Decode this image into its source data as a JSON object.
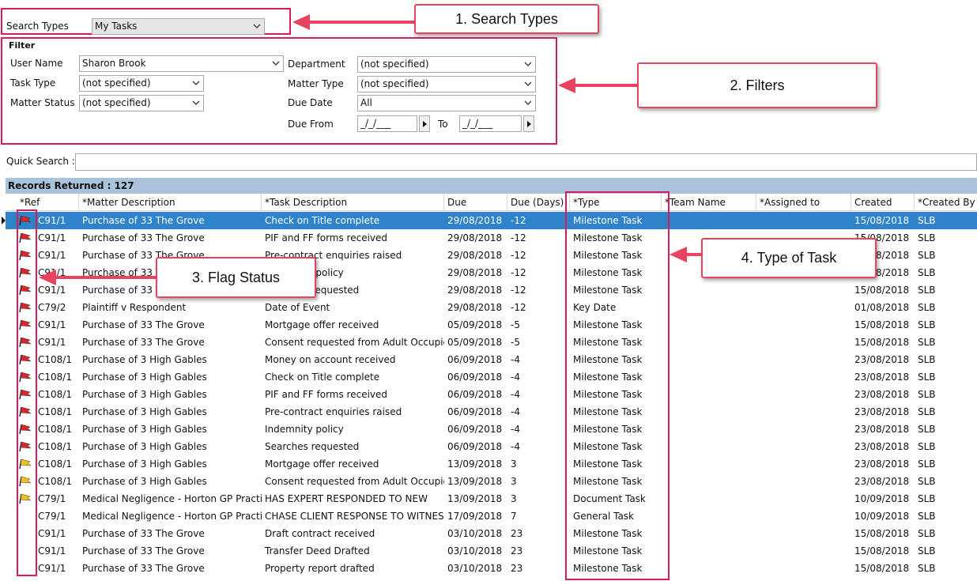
{
  "search": {
    "label": "Search Types",
    "value": "My Tasks"
  },
  "filter": {
    "title": "Filter",
    "user_name_label": "User Name",
    "user_name_value": "Sharon Brook",
    "task_type_label": "Task Type",
    "task_type_value": "(not specified)",
    "matter_status_label": "Matter Status",
    "matter_status_value": "(not specified)",
    "department_label": "Department",
    "department_value": "(not specified)",
    "matter_type_label": "Matter Type",
    "matter_type_value": "(not specified)",
    "due_date_label": "Due Date",
    "due_date_value": "All",
    "due_from_label": "Due From",
    "due_from_value": "_/_/___",
    "to_label": "To",
    "to_value": "_/_/___"
  },
  "quick_search": {
    "label": "Quick Search :",
    "value": ""
  },
  "records": {
    "label": "Records Returned : 127"
  },
  "columns": [
    "*Ref",
    "*Matter Description",
    "*Task Description",
    "Due",
    "Due (Days)",
    "*Type",
    "*Team Name",
    "*Assigned to",
    "Created",
    "*Created By"
  ],
  "rows": [
    {
      "flag": "red",
      "ref": "C91/1",
      "matter": "Purchase of 33 The Grove",
      "task": "Check on Title complete",
      "due": "29/08/2018",
      "days": "-12",
      "type": "Milestone Task",
      "team": "",
      "assigned": "",
      "created": "15/08/2018",
      "by": "SLB"
    },
    {
      "flag": "red",
      "ref": "C91/1",
      "matter": "Purchase of 33 The Grove",
      "task": "PIF and FF forms received",
      "due": "29/08/2018",
      "days": "-12",
      "type": "Milestone Task",
      "team": "",
      "assigned": "",
      "created": "15/08/2018",
      "by": "SLB"
    },
    {
      "flag": "red",
      "ref": "C91/1",
      "matter": "Purchase of 33 The Grove",
      "task": "Pre-contract enquiries raised",
      "due": "29/08/2018",
      "days": "-12",
      "type": "Milestone Task",
      "team": "",
      "assigned": "",
      "created": "15/08/2018",
      "by": "SLB"
    },
    {
      "flag": "red",
      "ref": "C91/1",
      "matter": "Purchase of 33 The Grove",
      "task": "Indemnity policy",
      "due": "29/08/2018",
      "days": "-12",
      "type": "Milestone Task",
      "team": "",
      "assigned": "",
      "created": "15/08/2018",
      "by": "SLB"
    },
    {
      "flag": "red",
      "ref": "C91/1",
      "matter": "Purchase of 33 The Grove",
      "task": "Searches requested",
      "due": "29/08/2018",
      "days": "-12",
      "type": "Milestone Task",
      "team": "",
      "assigned": "",
      "created": "15/08/2018",
      "by": "SLB"
    },
    {
      "flag": "red",
      "ref": "C79/2",
      "matter": "Plaintiff v Respondent",
      "task": "Date of Event",
      "due": "29/08/2018",
      "days": "-12",
      "type": "Key Date",
      "team": "",
      "assigned": "",
      "created": "01/08/2018",
      "by": "SLB"
    },
    {
      "flag": "red",
      "ref": "C91/1",
      "matter": "Purchase of 33 The Grove",
      "task": "Mortgage offer received",
      "due": "05/09/2018",
      "days": "-5",
      "type": "Milestone Task",
      "team": "",
      "assigned": "",
      "created": "15/08/2018",
      "by": "SLB"
    },
    {
      "flag": "red",
      "ref": "C91/1",
      "matter": "Purchase of 33 The Grove",
      "task": "Consent requested from Adult Occupiers",
      "due": "05/09/2018",
      "days": "-5",
      "type": "Milestone Task",
      "team": "",
      "assigned": "",
      "created": "15/08/2018",
      "by": "SLB"
    },
    {
      "flag": "red",
      "ref": "C108/1",
      "matter": "Purchase of 3 High Gables",
      "task": "Money on account received",
      "due": "06/09/2018",
      "days": "-4",
      "type": "Milestone Task",
      "team": "",
      "assigned": "",
      "created": "23/08/2018",
      "by": "SLB"
    },
    {
      "flag": "red",
      "ref": "C108/1",
      "matter": "Purchase of 3 High Gables",
      "task": "Check on Title complete",
      "due": "06/09/2018",
      "days": "-4",
      "type": "Milestone Task",
      "team": "",
      "assigned": "",
      "created": "23/08/2018",
      "by": "SLB"
    },
    {
      "flag": "red",
      "ref": "C108/1",
      "matter": "Purchase of 3 High Gables",
      "task": "PIF and FF forms received",
      "due": "06/09/2018",
      "days": "-4",
      "type": "Milestone Task",
      "team": "",
      "assigned": "",
      "created": "23/08/2018",
      "by": "SLB"
    },
    {
      "flag": "red",
      "ref": "C108/1",
      "matter": "Purchase of 3 High Gables",
      "task": "Pre-contract enquiries raised",
      "due": "06/09/2018",
      "days": "-4",
      "type": "Milestone Task",
      "team": "",
      "assigned": "",
      "created": "23/08/2018",
      "by": "SLB"
    },
    {
      "flag": "red",
      "ref": "C108/1",
      "matter": "Purchase of 3 High Gables",
      "task": "Indemnity policy",
      "due": "06/09/2018",
      "days": "-4",
      "type": "Milestone Task",
      "team": "",
      "assigned": "",
      "created": "23/08/2018",
      "by": "SLB"
    },
    {
      "flag": "red",
      "ref": "C108/1",
      "matter": "Purchase of 3 High Gables",
      "task": "Searches requested",
      "due": "06/09/2018",
      "days": "-4",
      "type": "Milestone Task",
      "team": "",
      "assigned": "",
      "created": "23/08/2018",
      "by": "SLB"
    },
    {
      "flag": "yellow",
      "ref": "C108/1",
      "matter": "Purchase of 3 High Gables",
      "task": "Mortgage offer received",
      "due": "13/09/2018",
      "days": "3",
      "type": "Milestone Task",
      "team": "",
      "assigned": "",
      "created": "23/08/2018",
      "by": "SLB"
    },
    {
      "flag": "yellow",
      "ref": "C108/1",
      "matter": "Purchase of 3 High Gables",
      "task": "Consent requested from Adult Occupiers",
      "due": "13/09/2018",
      "days": "3",
      "type": "Milestone Task",
      "team": "",
      "assigned": "",
      "created": "23/08/2018",
      "by": "SLB"
    },
    {
      "flag": "yellow",
      "ref": "C79/1",
      "matter": "Medical Negligence - Horton GP Practice",
      "task": "HAS EXPERT RESPONDED TO NEW",
      "due": "13/09/2018",
      "days": "3",
      "type": "Document Task",
      "team": "",
      "assigned": "",
      "created": "10/09/2018",
      "by": "SLB"
    },
    {
      "flag": "none",
      "ref": "C79/1",
      "matter": "Medical Negligence - Horton GP Practice",
      "task": "CHASE CLIENT RESPONSE TO WITNESS",
      "due": "17/09/2018",
      "days": "7",
      "type": "General Task",
      "team": "",
      "assigned": "",
      "created": "10/09/2018",
      "by": "SLB"
    },
    {
      "flag": "none",
      "ref": "C91/1",
      "matter": "Purchase of 33 The Grove",
      "task": "Draft contract received",
      "due": "03/10/2018",
      "days": "23",
      "type": "Milestone Task",
      "team": "",
      "assigned": "",
      "created": "15/08/2018",
      "by": "SLB"
    },
    {
      "flag": "none",
      "ref": "C91/1",
      "matter": "Purchase of 33 The Grove",
      "task": "Transfer Deed Drafted",
      "due": "03/10/2018",
      "days": "23",
      "type": "Milestone Task",
      "team": "",
      "assigned": "",
      "created": "15/08/2018",
      "by": "SLB"
    },
    {
      "flag": "none",
      "ref": "C91/1",
      "matter": "Purchase of 33 The Grove",
      "task": "Property report drafted",
      "due": "03/10/2018",
      "days": "23",
      "type": "Milestone Task",
      "team": "",
      "assigned": "",
      "created": "15/08/2018",
      "by": "SLB"
    }
  ],
  "selected_row": 0,
  "callouts": {
    "c1": "1.  Search Types",
    "c2": "2.  Filters",
    "c3": "3.  Flag Status",
    "c4": "4. Type of Task"
  },
  "colors": {
    "highlight": "#d81b60",
    "callout_border": "#e8435f",
    "arrow": "#e8435f",
    "selection": "#2e83c9",
    "records_bar": "#aac3dd",
    "flag_red": "#d9262c",
    "flag_yellow": "#f2c21b"
  }
}
